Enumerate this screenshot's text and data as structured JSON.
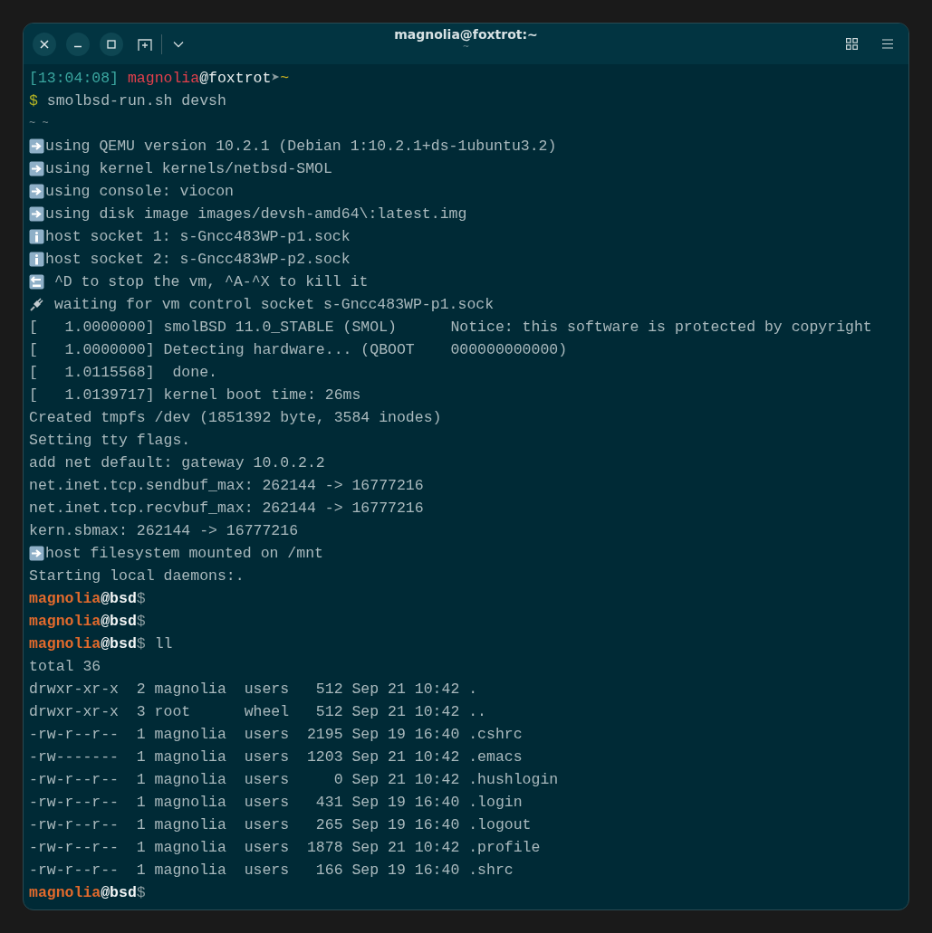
{
  "window": {
    "title": "magnolia@foxtrot:~",
    "subtitle": "~"
  },
  "terminal": {
    "lines": [
      {
        "kind": "plain",
        "spans": [
          {
            "text": "[13:04:08] ",
            "kind": "timestamp"
          },
          {
            "text": "magnolia",
            "kind": "user"
          },
          {
            "text": "@foxtrot",
            "kind": "host"
          },
          {
            "text": "➤",
            "kind": "separator"
          },
          {
            "text": "~",
            "kind": "directory"
          }
        ]
      },
      {
        "kind": "plain",
        "spans": [
          {
            "text": "$ ",
            "kind": "prompt"
          },
          {
            "text": "smolbsd-run.sh devsh",
            "kind": "output"
          }
        ]
      },
      {
        "kind": "plain",
        "spans": [
          {
            "text": "~ ~",
            "kind": "faint"
          }
        ]
      },
      {
        "kind": "arrow",
        "spans": [
          {
            "text": "using QEMU version 10.2.1 (Debian 1:10.2.1+ds-1ubuntu3.2)",
            "kind": "output"
          }
        ]
      },
      {
        "kind": "arrow",
        "spans": [
          {
            "text": "using kernel kernels/netbsd-SMOL",
            "kind": "output"
          }
        ]
      },
      {
        "kind": "arrow",
        "spans": [
          {
            "text": "using console: viocon",
            "kind": "output"
          }
        ]
      },
      {
        "kind": "arrow",
        "spans": [
          {
            "text": "using disk image images/devsh-amd64\\:latest.img",
            "kind": "output"
          }
        ]
      },
      {
        "kind": "info",
        "spans": [
          {
            "text": "host socket 1: s-Gncc483WP-p1.sock",
            "kind": "output"
          }
        ]
      },
      {
        "kind": "info",
        "spans": [
          {
            "text": "host socket 2: s-Gncc483WP-p2.sock",
            "kind": "output"
          }
        ]
      },
      {
        "kind": "back",
        "spans": [
          {
            "text": " ^D to stop the vm, ^A-^X to kill it",
            "kind": "output"
          }
        ]
      },
      {
        "kind": "plug",
        "spans": [
          {
            "text": " waiting for vm control socket s-Gncc483WP-p1.sock",
            "kind": "output"
          }
        ]
      },
      {
        "kind": "plain",
        "spans": [
          {
            "text": "[   1.0000000] smolBSD 11.0_STABLE (SMOL)      Notice: this software is protected by copyright",
            "kind": "output"
          }
        ]
      },
      {
        "kind": "plain",
        "spans": [
          {
            "text": "[   1.0000000] Detecting hardware... (QBOOT    000000000000)",
            "kind": "output"
          }
        ]
      },
      {
        "kind": "plain",
        "spans": [
          {
            "text": "[   1.0115568]  done.",
            "kind": "output"
          }
        ]
      },
      {
        "kind": "plain",
        "spans": [
          {
            "text": "[   1.0139717] kernel boot time: 26ms",
            "kind": "output"
          }
        ]
      },
      {
        "kind": "plain",
        "spans": [
          {
            "text": "Created tmpfs /dev (1851392 byte, 3584 inodes)",
            "kind": "output"
          }
        ]
      },
      {
        "kind": "plain",
        "spans": [
          {
            "text": "Setting tty flags.",
            "kind": "output"
          }
        ]
      },
      {
        "kind": "plain",
        "spans": [
          {
            "text": "add net default: gateway 10.0.2.2",
            "kind": "output"
          }
        ]
      },
      {
        "kind": "plain",
        "spans": [
          {
            "text": "net.inet.tcp.sendbuf_max: 262144 -> 16777216",
            "kind": "output"
          }
        ]
      },
      {
        "kind": "plain",
        "spans": [
          {
            "text": "net.inet.tcp.recvbuf_max: 262144 -> 16777216",
            "kind": "output"
          }
        ]
      },
      {
        "kind": "plain",
        "spans": [
          {
            "text": "kern.sbmax: 262144 -> 16777216",
            "kind": "output"
          }
        ]
      },
      {
        "kind": "arrow",
        "spans": [
          {
            "text": "host filesystem mounted on /mnt",
            "kind": "output"
          }
        ]
      },
      {
        "kind": "plain",
        "spans": [
          {
            "text": "Starting local daemons:.",
            "kind": "output"
          }
        ]
      },
      {
        "kind": "plain",
        "spans": [
          {
            "text": "magnolia",
            "kind": "guest-user"
          },
          {
            "text": "@bsd",
            "kind": "guest-host"
          },
          {
            "text": "$",
            "kind": "guest-prompt"
          }
        ]
      },
      {
        "kind": "plain",
        "spans": [
          {
            "text": "magnolia",
            "kind": "guest-user"
          },
          {
            "text": "@bsd",
            "kind": "guest-host"
          },
          {
            "text": "$",
            "kind": "guest-prompt"
          }
        ]
      },
      {
        "kind": "plain",
        "spans": [
          {
            "text": "magnolia",
            "kind": "guest-user"
          },
          {
            "text": "@bsd",
            "kind": "guest-host"
          },
          {
            "text": "$",
            "kind": "guest-prompt"
          },
          {
            "text": " ll",
            "kind": "output"
          }
        ]
      },
      {
        "kind": "plain",
        "spans": [
          {
            "text": "total 36",
            "kind": "output"
          }
        ]
      },
      {
        "kind": "plain",
        "spans": [
          {
            "text": "drwxr-xr-x  2 magnolia  users   512 Sep 21 10:42 .",
            "kind": "output"
          }
        ]
      },
      {
        "kind": "plain",
        "spans": [
          {
            "text": "drwxr-xr-x  3 root      wheel   512 Sep 21 10:42 ..",
            "kind": "output"
          }
        ]
      },
      {
        "kind": "plain",
        "spans": [
          {
            "text": "-rw-r--r--  1 magnolia  users  2195 Sep 19 16:40 .cshrc",
            "kind": "output"
          }
        ]
      },
      {
        "kind": "plain",
        "spans": [
          {
            "text": "-rw-------  1 magnolia  users  1203 Sep 21 10:42 .emacs",
            "kind": "output"
          }
        ]
      },
      {
        "kind": "plain",
        "spans": [
          {
            "text": "-rw-r--r--  1 magnolia  users     0 Sep 21 10:42 .hushlogin",
            "kind": "output"
          }
        ]
      },
      {
        "kind": "plain",
        "spans": [
          {
            "text": "-rw-r--r--  1 magnolia  users   431 Sep 19 16:40 .login",
            "kind": "output"
          }
        ]
      },
      {
        "kind": "plain",
        "spans": [
          {
            "text": "-rw-r--r--  1 magnolia  users   265 Sep 19 16:40 .logout",
            "kind": "output"
          }
        ]
      },
      {
        "kind": "plain",
        "spans": [
          {
            "text": "-rw-r--r--  1 magnolia  users  1878 Sep 21 10:42 .profile",
            "kind": "output"
          }
        ]
      },
      {
        "kind": "plain",
        "spans": [
          {
            "text": "-rw-r--r--  1 magnolia  users   166 Sep 19 16:40 .shrc",
            "kind": "output"
          }
        ]
      },
      {
        "kind": "plain",
        "spans": [
          {
            "text": "magnolia",
            "kind": "guest-user"
          },
          {
            "text": "@bsd",
            "kind": "guest-host"
          },
          {
            "text": "$",
            "kind": "guest-prompt"
          }
        ]
      }
    ]
  }
}
